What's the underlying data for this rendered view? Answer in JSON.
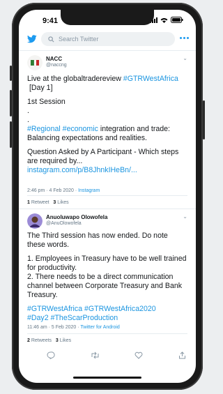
{
  "status": {
    "time": "9:41"
  },
  "search": {
    "placeholder": "Search Twitter"
  },
  "tweets": [
    {
      "name": "NACC",
      "handle": "@naccng",
      "lines": [
        "Live at the globaltradereview ",
        "#GTRWestAfrica",
        "[Day 1]",
        "1st Session",
        ".",
        ".",
        "#Regional",
        "#economic",
        " integration and trade:",
        "Balancing expectations and realities.",
        "Question Asked by A Participant - Which steps",
        "are required by...",
        "instagram.com/p/B8JhnkIHeBn/..."
      ],
      "time": "2:46 pm · 4 Feb 2020 · ",
      "source": "Instagram",
      "retweets": "1",
      "retweets_label": "Retweet",
      "likes": "3",
      "likes_label": "Likes"
    },
    {
      "name": "Anuoluwapo Olowofela",
      "handle": "@AnuOlowofela",
      "lines": [
        "The Third session has now ended. Do note",
        "these words.",
        "1. Employees in Treasury have to be well trained",
        "for productivity.",
        "2. There needs to be a direct communication",
        "channel between Corporate Treasury and Bank",
        "Treasury.",
        "#GTRWestAfrica #GTRWestAfrica2020",
        "#Day2 #TheScarProduction"
      ],
      "time": "11:46 am · 5 Feb 2020 · ",
      "source": "Twitter for Android",
      "retweets": "2",
      "retweets_label": "Retweets",
      "likes": "3",
      "likes_label": "Likes"
    }
  ],
  "colors": {
    "accent": "#1b95e0",
    "text": "#14171a",
    "muted": "#657786"
  }
}
